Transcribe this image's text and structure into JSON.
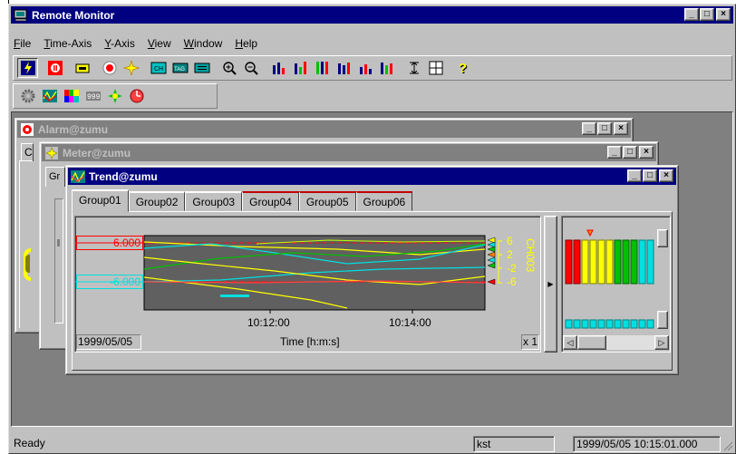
{
  "app": {
    "title": "Remote Monitor"
  },
  "menu": [
    "File",
    "Time-Axis",
    "Y-Axis",
    "View",
    "Window",
    "Help"
  ],
  "menu_accel": [
    "F",
    "T",
    "Y",
    "V",
    "W",
    "H"
  ],
  "windows": {
    "alarm": {
      "title": "Alarm@zumu",
      "fragment": "C"
    },
    "meter": {
      "title": "Meter@zumu",
      "fragment": "Gr"
    },
    "trend": {
      "title": "Trend@zumu"
    }
  },
  "trend": {
    "tabs": [
      "Group01",
      "Group02",
      "Group03",
      "Group04",
      "Group05",
      "Group06"
    ],
    "active_tab": 0,
    "y_upper": "6.000",
    "y_lower": "-6.000",
    "scale_ticks": [
      "6",
      "2",
      "-2",
      "-6"
    ],
    "channel": "CH003",
    "time_ticks": [
      "10:12:00",
      "10:14:00"
    ],
    "date": "1999/05/05",
    "time_axis_label": "Time [h:m:s]",
    "zoom": "x 1"
  },
  "status": {
    "left": "Ready",
    "user": "kst",
    "datetime": "1999/05/05 10:15:01.000"
  },
  "colors": {
    "title_active": "#000080",
    "title_inactive": "#808080",
    "face": "#c0c0c0",
    "red": "#ff0000",
    "yellow": "#ffff00",
    "green": "#00c000",
    "cyan": "#00e0e0"
  }
}
